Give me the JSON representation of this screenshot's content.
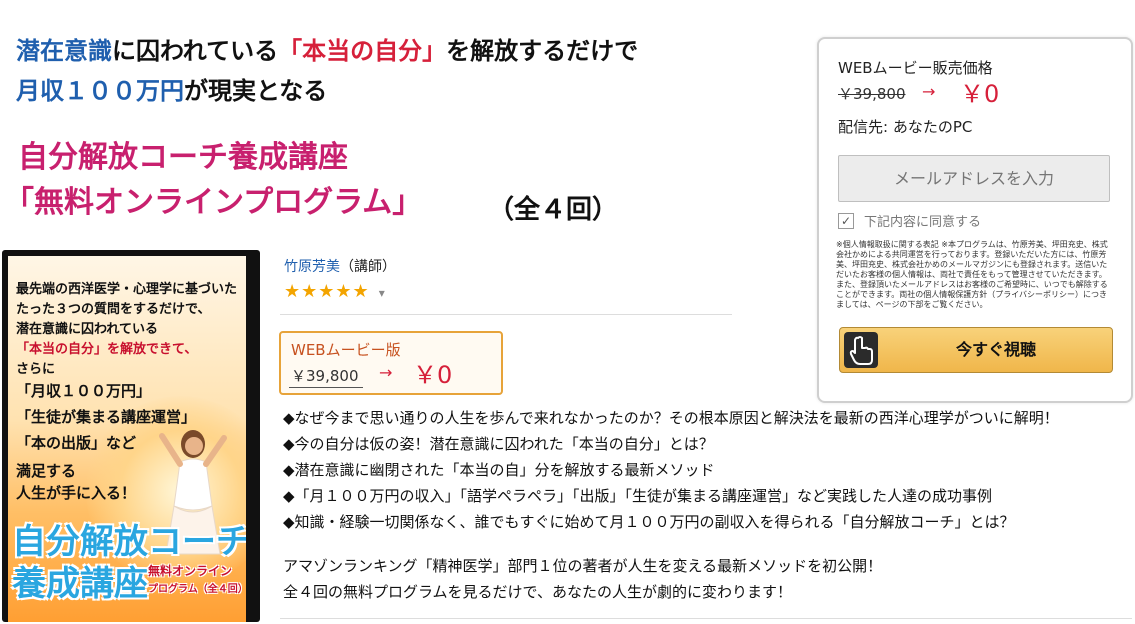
{
  "headline": {
    "line1": [
      {
        "text": "潜在意識",
        "color": "blue"
      },
      {
        "text": "に囚われている",
        "color": "black"
      },
      {
        "text": "「本当の自分」",
        "color": "red"
      },
      {
        "text": "を解放するだけで",
        "color": "black"
      }
    ],
    "line2": [
      {
        "text": "月収１００万円",
        "color": "blue"
      },
      {
        "text": "が現実となる",
        "color": "black"
      }
    ],
    "course_title": "自分解放コーチ養成講座",
    "program_title": "「無料オンラインプログラム」",
    "sessions": "（全４回）"
  },
  "cover": {
    "lines": [
      "最先端の西洋医学・心理学に基づいた",
      "たった３つの質問をするだけで、",
      "潜在意識に囚われている",
      "「本当の自分」を解放できて、",
      "さらに",
      "「月収１００万円」",
      "「生徒が集まる講座運営」",
      "「本の出版」など",
      "満足する",
      "人生が手に入る！"
    ],
    "title1": "自分解放コーチ",
    "title2": "養成講座",
    "subtitle1": "無料オンライン",
    "subtitle2": "プログラム（全４回）"
  },
  "info": {
    "author": "竹原芳美",
    "author_role": "（講師）",
    "stars": "★★★★★",
    "stars_dropdown": "▾",
    "format_label": "WEBムービー版",
    "original_price": "￥39,800",
    "arrow": "→",
    "price": "￥0"
  },
  "bullets": [
    "◆なぜ今まで思い通りの人生を歩んで来れなかったのか？その根本原因と解決法を最新の西洋心理学がついに解明！",
    "◆今の自分は仮の姿！潜在意識に囚われた「本当の自分」とは？",
    "◆潜在意識に幽閉された「本当の自」分を解放する最新メソッド",
    "◆「月１００万円の収入」「語学ペラペラ」「出版」「生徒が集まる講座運営」など実践した人達の成功事例",
    "◆知識・経験一切関係なく、誰でもすぐに始めて月１００万円の副収入を得られる「自分解放コーチ」とは？"
  ],
  "description": [
    "アマゾンランキング「精神医学」部門１位の著者が人生を変える最新メソッドを初公開！",
    "全４回の無料プログラムを見るだけで、あなたの人生が劇的に変わります！"
  ],
  "panel": {
    "price_label": "WEBムービー販売価格",
    "original_price": "￥39,800",
    "arrow": "→",
    "price": "￥0",
    "delivery": "配信先: あなたのPC",
    "email_placeholder": "メールアドレスを入力",
    "agree_label": "下記内容に同意する",
    "fine_print": "※個人情報取扱に関する表記 ※本プログラムは、竹原芳美、坪田充史、株式会社かめによる共同運営を行っております。登録いただいた方には、竹原芳美、坪田充史、株式会社かめのメールマガジンにも登録されます。送信いただいたお客様の個人情報は、両社で責任をもって管理させていただきます。また、登録頂いたメールアドレスはお客様のご希望時に、いつでも解除することができます。両社の個人情報保護方針（プライバシーポリシー）につきましては、ページの下部をご覧ください。",
    "buy_label": "今すぐ視聴"
  }
}
